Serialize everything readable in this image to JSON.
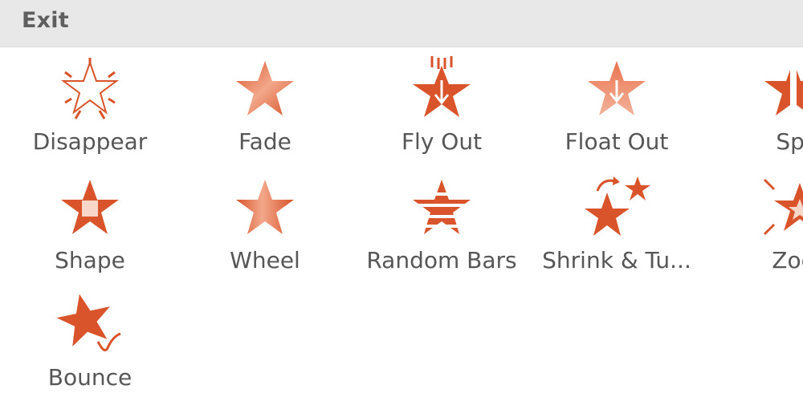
{
  "section": {
    "title": "Exit"
  },
  "effects": [
    {
      "label": "Disappear",
      "icon": "disappear-star-icon"
    },
    {
      "label": "Fade",
      "icon": "fade-star-icon"
    },
    {
      "label": "Fly Out",
      "icon": "fly-out-star-icon"
    },
    {
      "label": "Float Out",
      "icon": "float-out-star-icon"
    },
    {
      "label": "Spl",
      "icon": "split-star-icon"
    },
    {
      "label": "Shape",
      "icon": "shape-star-icon"
    },
    {
      "label": "Wheel",
      "icon": "wheel-star-icon"
    },
    {
      "label": "Random Bars",
      "icon": "random-bars-star-icon"
    },
    {
      "label": "Shrink & Tu...",
      "icon": "shrink-turn-star-icon"
    },
    {
      "label": "Zoo",
      "icon": "zoom-star-icon"
    },
    {
      "label": "Bounce",
      "icon": "bounce-star-icon"
    }
  ],
  "colors": {
    "accent": "#d9532b",
    "accent_light": "#f0a487",
    "text": "#565656",
    "header_bg": "#e8e8e8"
  }
}
